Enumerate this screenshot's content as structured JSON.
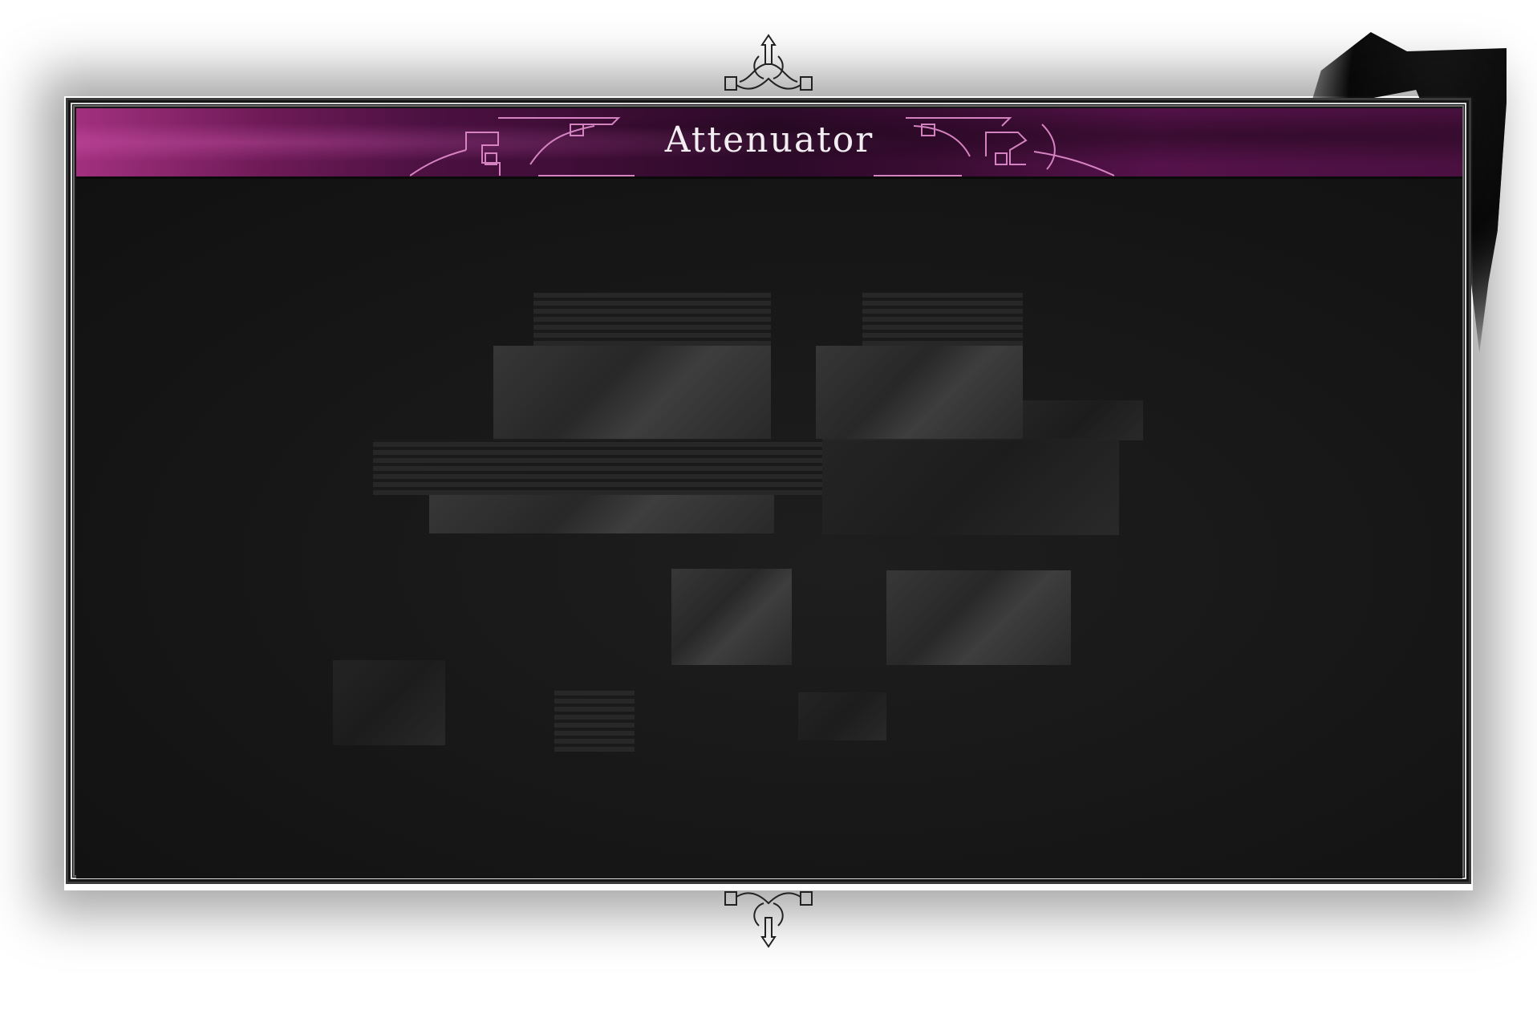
{
  "window": {
    "title": "Attenuator"
  },
  "colors": {
    "header_accent": "#a2307f",
    "header_dark": "#2c0a28",
    "panel_background": "#161616",
    "title_text": "#f3eef2",
    "ornament_line": "#e58fd0"
  },
  "icons": {
    "top_ornament": "arrow-up-ornament-icon",
    "bottom_ornament": "arrow-down-ornament-icon",
    "header_left_ornament": "filigree-left-icon",
    "header_right_ornament": "filigree-right-icon"
  }
}
